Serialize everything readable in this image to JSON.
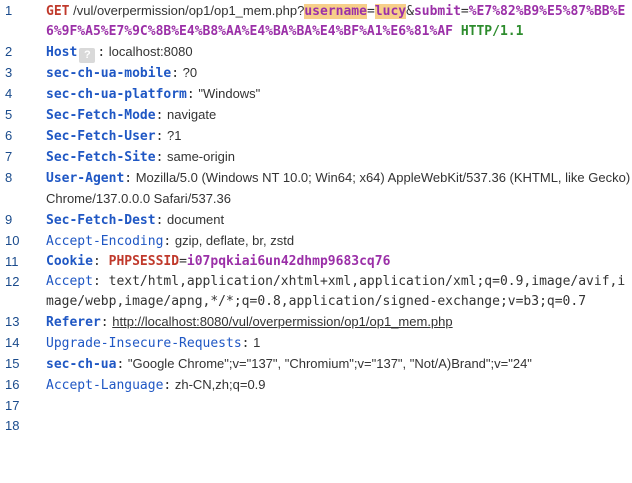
{
  "lines": [
    {
      "n": "1",
      "method": "GET",
      "path": " /vul/overpermission/op1/op1_mem.php?",
      "q1_key": "username",
      "q1_eq": "=",
      "q1_val": "lucy",
      "amp": "&",
      "q2_key": "submit",
      "q2_eq": "=",
      "q2_val": "%E7%82%B9%E5%87%BB%E6%9F%A5%E7%9C%8B%E4%B8%AA%E4%BA%BA%E4%BF%A1%E6%81%AF",
      "proto": " HTTP/1.1"
    },
    {
      "n": "2",
      "name": "Host",
      "badge": "?",
      "colon": ":",
      "value": " localhost:8080"
    },
    {
      "n": "3",
      "name": "sec-ch-ua-mobile",
      "colon": ":",
      "value": " ?0"
    },
    {
      "n": "4",
      "name": "sec-ch-ua-platform",
      "colon": ":",
      "value": " \"Windows\""
    },
    {
      "n": "5",
      "name": "Sec-Fetch-Mode",
      "colon": ":",
      "value": " navigate"
    },
    {
      "n": "6",
      "name": "Sec-Fetch-User",
      "colon": ":",
      "value": " ?1"
    },
    {
      "n": "7",
      "name": "Sec-Fetch-Site",
      "colon": ":",
      "value": " same-origin"
    },
    {
      "n": "8",
      "name": "User-Agent",
      "colon": ":",
      "value": " Mozilla/5.0 (Windows NT 10.0; Win64; x64) AppleWebKit/537.36 (KHTML, like Gecko) Chrome/137.0.0.0 Safari/537.36"
    },
    {
      "n": "9",
      "name": "Sec-Fetch-Dest",
      "colon": ":",
      "value": " document"
    },
    {
      "n": "10",
      "name": "Accept-Encoding",
      "colon": ":",
      "value": " gzip, deflate, br, zstd"
    },
    {
      "n": "11",
      "name": "Cookie",
      "colon": ":",
      "cookie_key": " PHPSESSID",
      "cookie_eq": "=",
      "cookie_val": "i07pqkiai6un42dhmp9683cq76"
    },
    {
      "n": "12",
      "name": "Accept",
      "colon": ":",
      "value": " text/html,application/xhtml+xml,application/xml;q=0.9,image/avif,image/webp,image/apng,*/*;q=0.8,application/signed-exchange;v=b3;q=0.7"
    },
    {
      "n": "13",
      "name": "Referer",
      "colon": ":",
      "value": " ",
      "link": "http://localhost:8080/vul/overpermission/op1/op1_mem.php"
    },
    {
      "n": "14",
      "name": "Upgrade-Insecure-Requests",
      "colon": ":",
      "value": " 1"
    },
    {
      "n": "15",
      "name": "sec-ch-ua",
      "colon": ":",
      "value": " \"Google Chrome\";v=\"137\", \"Chromium\";v=\"137\", \"Not/A)Brand\";v=\"24\""
    },
    {
      "n": "16",
      "name": "Accept-Language",
      "colon": ":",
      "value": " zh-CN,zh;q=0.9"
    },
    {
      "n": "17"
    },
    {
      "n": "18"
    }
  ]
}
